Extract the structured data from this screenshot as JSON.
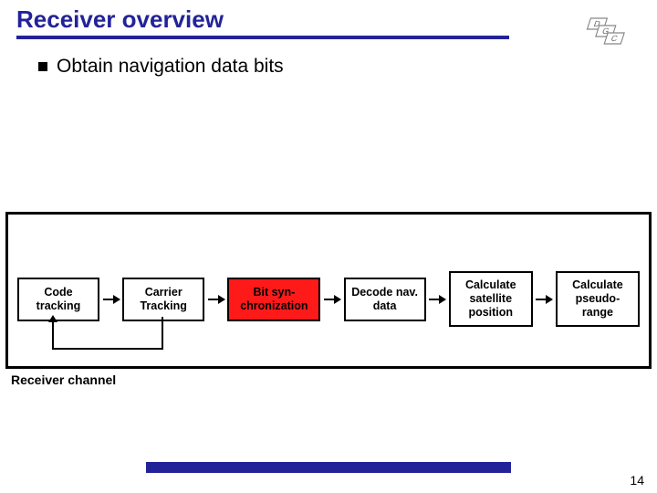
{
  "title": "Receiver overview",
  "bullet": "Obtain navigation data bits",
  "nodes": [
    "Code tracking",
    "Carrier Tracking",
    "Bit syn-\nchronization",
    "Decode nav. data",
    "Calculate satellite position",
    "Calculate pseudo-\nrange"
  ],
  "highlight_index": 2,
  "channel_label": "Receiver channel",
  "page_number": "14",
  "logo_letters": [
    "D",
    "G",
    "C"
  ]
}
